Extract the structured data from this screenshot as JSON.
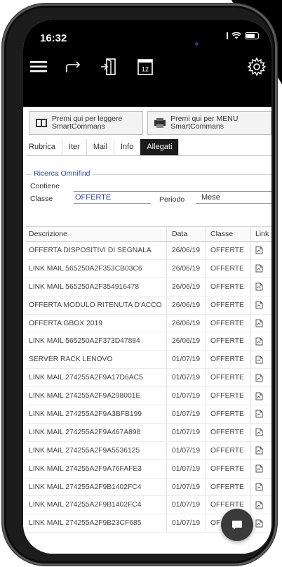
{
  "status_bar": {
    "time": "16:32"
  },
  "top_toolbar": {
    "icons": [
      "menu-icon",
      "forward-icon",
      "exit-door-icon",
      "calendar-icon",
      "settings-gear-icon"
    ],
    "calendar_day": "12"
  },
  "commands": {
    "read_button": {
      "line1": "Premi qui per leggere",
      "line2": "SmartCommans"
    },
    "menu_button": {
      "line1": "Premi qui per MENU",
      "line2": "SmartCommans"
    }
  },
  "tabs": [
    {
      "label": "Rubrica",
      "active": false
    },
    {
      "label": "Iter",
      "active": false
    },
    {
      "label": "Mail",
      "active": false
    },
    {
      "label": "Info",
      "active": false
    },
    {
      "label": "Allegati",
      "active": true
    }
  ],
  "search": {
    "title": "Ricerca Omnifind",
    "contiene_label": "Contiene",
    "contiene_value": "",
    "classe_label": "Classe",
    "classe_value": "OFFERTE",
    "periodo_label": "Periodo",
    "periodo_value": "Mese"
  },
  "table": {
    "columns": [
      "Descrizione",
      "Data",
      "Classe",
      "Link"
    ],
    "rows": [
      {
        "descrizione": "OFFERTA DISPOSITIVI DI SEGNALA",
        "data": "26/06/19",
        "classe": "OFFERTE"
      },
      {
        "descrizione": "LINK MAIL 565250A2F353CB03C6",
        "data": "26/06/19",
        "classe": "OFFERTE"
      },
      {
        "descrizione": "LINK MAIL 565250A2F354916478",
        "data": "26/06/19",
        "classe": "OFFERTE"
      },
      {
        "descrizione": "OFFERTA MODULO RITENUTA D'ACCO",
        "data": "26/06/19",
        "classe": "OFFERTE"
      },
      {
        "descrizione": "OFFERTA GBOX 2019",
        "data": "26/06/19",
        "classe": "OFFERTE"
      },
      {
        "descrizione": "LINK MAIL 565250A2F373D47884",
        "data": "26/06/19",
        "classe": "OFFERTE"
      },
      {
        "descrizione": "SERVER RACK LENOVO",
        "data": "01/07/19",
        "classe": "OFFERTE"
      },
      {
        "descrizione": "LINK MAIL 274255A2F9A17D6AC5",
        "data": "01/07/19",
        "classe": "OFFERTE"
      },
      {
        "descrizione": "LINK MAIL 274255A2F9A298001E",
        "data": "01/07/19",
        "classe": "OFFERTE"
      },
      {
        "descrizione": "LINK MAIL 274255A2F9A3BFB199",
        "data": "01/07/19",
        "classe": "OFFERTE"
      },
      {
        "descrizione": "LINK MAIL 274255A2F9A467A898",
        "data": "01/07/19",
        "classe": "OFFERTE"
      },
      {
        "descrizione": "LINK MAIL 274255A2F9A5536125",
        "data": "01/07/19",
        "classe": "OFFERTE"
      },
      {
        "descrizione": "LINK MAIL 274255A2F9A76FAFE3",
        "data": "01/07/19",
        "classe": "OFFERTE"
      },
      {
        "descrizione": "LINK MAIL 274255A2F9B1402FC4",
        "data": "01/07/19",
        "classe": "OFFERTE"
      },
      {
        "descrizione": "LINK MAIL 274255A2F9B1402FC4",
        "data": "01/07/19",
        "classe": "OFFERTE"
      },
      {
        "descrizione": "LINK MAIL 274255A2F9B23CF685",
        "data": "01/07/19",
        "classe": "OF"
      }
    ]
  },
  "fab": {
    "icon": "chat-icon"
  },
  "colors": {
    "accent_blue": "#2a4bb3",
    "active_tab": "#1b1b1b",
    "topbar": "#000000"
  }
}
